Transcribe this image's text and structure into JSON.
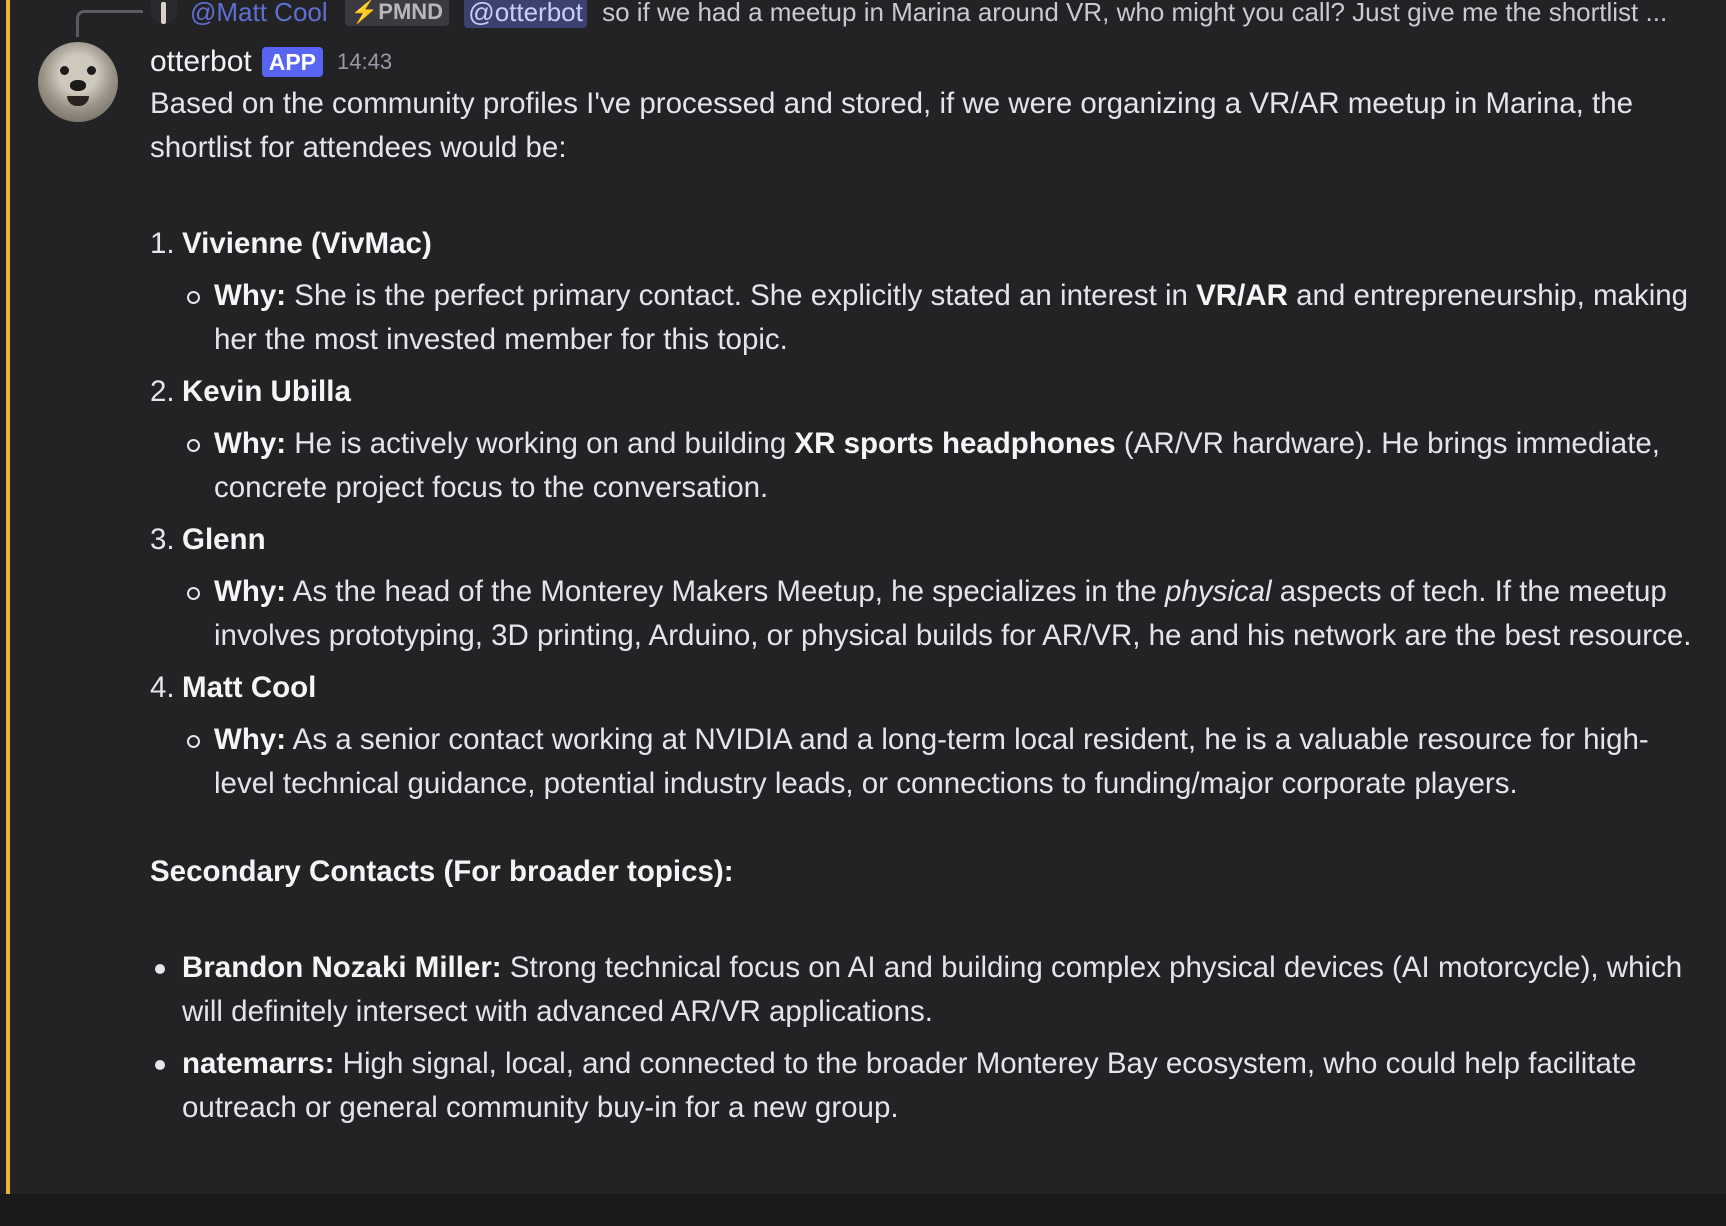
{
  "reply": {
    "author": "@Matt Cool",
    "tag": "⚡PMND",
    "mention": "@otterbot",
    "text": "so if we had a meetup in Marina around VR, who might you call? Just give me the shortlist ..."
  },
  "message": {
    "username": "otterbot",
    "badge": "APP",
    "time": "14:43",
    "intro": "Based on the community profiles I've processed and stored, if we were organizing a VR/AR meetup in Marina, the shortlist for attendees would be:",
    "items": [
      {
        "number": "1.",
        "name": "Vivienne (VivMac)",
        "why_label": "Why:",
        "why_a": " She is the perfect primary contact. She explicitly stated an interest in ",
        "why_b": "VR/AR",
        "why_c": " and entrepreneurship, making her the most invested member for this topic."
      },
      {
        "number": "2.",
        "name": "Kevin Ubilla",
        "why_label": "Why:",
        "why_a": " He is actively working on and building ",
        "why_b": "XR sports headphones",
        "why_c": " (AR/VR hardware). He brings immediate, concrete project focus to the conversation."
      },
      {
        "number": "3.",
        "name": "Glenn",
        "why_label": "Why:",
        "why_a": " As the head of the Monterey Makers Meetup, he specializes in the ",
        "why_b": "physical",
        "why_c": " aspects of tech. If the meetup involves prototyping, 3D printing, Arduino, or physical builds for AR/VR, he and his network are the best resource."
      },
      {
        "number": "4.",
        "name": "Matt Cool",
        "why_label": "Why:",
        "why_a": " As a senior contact working at NVIDIA and a long-term local resident, he is a valuable resource for high-level technical guidance, potential industry leads, or connections to funding/major corporate players."
      }
    ],
    "secondary_heading": "Secondary Contacts (For broader topics):",
    "secondary": [
      {
        "name": "Brandon Nozaki Miller:",
        "text": " Strong technical focus on AI and building complex physical devices (AI motorcycle), which will definitely intersect with advanced AR/VR applications."
      },
      {
        "name": "natemarrs:",
        "text": " High signal, local, and connected to the broader Monterey Bay ecosystem, who could help facilitate outreach or general community buy-in for a new group."
      }
    ]
  },
  "colors": {
    "highlight_bar": "#f0b232",
    "app_badge": "#5865f2",
    "mention_bg": "#3c4270",
    "background": "#232326"
  }
}
